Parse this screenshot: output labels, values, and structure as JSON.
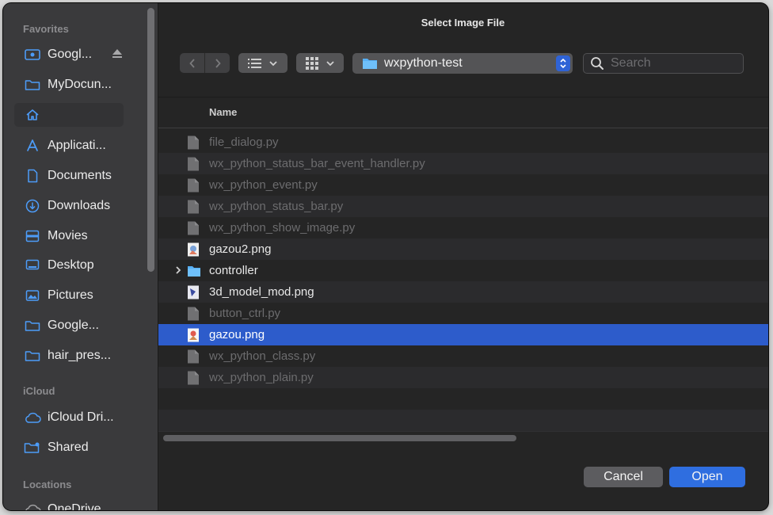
{
  "window": {
    "title": "Select Image File"
  },
  "sidebar": {
    "sections": [
      {
        "label": "Favorites",
        "items": [
          {
            "label": "Googl...",
            "icon": "drive-icon",
            "eject": true
          },
          {
            "label": "MyDocun...",
            "icon": "folder-icon"
          },
          {
            "label": "",
            "icon": "home-icon",
            "active": true
          },
          {
            "label": "Applicati...",
            "icon": "applications-icon"
          },
          {
            "label": "Documents",
            "icon": "document-icon"
          },
          {
            "label": "Downloads",
            "icon": "downloads-icon"
          },
          {
            "label": "Movies",
            "icon": "movies-icon"
          },
          {
            "label": "Desktop",
            "icon": "desktop-icon"
          },
          {
            "label": "Pictures",
            "icon": "pictures-icon"
          },
          {
            "label": "Google...",
            "icon": "folder-icon"
          },
          {
            "label": "hair_pres...",
            "icon": "folder-icon"
          }
        ]
      },
      {
        "label": "iCloud",
        "items": [
          {
            "label": "iCloud Dri...",
            "icon": "cloud-icon"
          },
          {
            "label": "Shared",
            "icon": "shared-folder-icon"
          }
        ]
      },
      {
        "label": "Locations",
        "items": [
          {
            "label": "OneDrive",
            "icon": "cloud-icon"
          }
        ]
      }
    ]
  },
  "toolbar": {
    "path": "wxpython-test",
    "search_placeholder": "Search"
  },
  "list": {
    "column_name": "Name",
    "files": [
      {
        "name": "file_dialog.py",
        "kind": "py",
        "enabled": false
      },
      {
        "name": "wx_python_status_bar_event_handler.py",
        "kind": "py",
        "enabled": false
      },
      {
        "name": "wx_python_event.py",
        "kind": "py",
        "enabled": false
      },
      {
        "name": "wx_python_status_bar.py",
        "kind": "py",
        "enabled": false
      },
      {
        "name": "wx_python_show_image.py",
        "kind": "py",
        "enabled": false
      },
      {
        "name": "gazou2.png",
        "kind": "png",
        "enabled": true
      },
      {
        "name": "controller",
        "kind": "folder",
        "enabled": true
      },
      {
        "name": "3d_model_mod.png",
        "kind": "png",
        "enabled": true
      },
      {
        "name": "button_ctrl.py",
        "kind": "py",
        "enabled": false
      },
      {
        "name": "gazou.png",
        "kind": "png",
        "enabled": true,
        "selected": true
      },
      {
        "name": "wx_python_class.py",
        "kind": "py",
        "enabled": false
      },
      {
        "name": "wx_python_plain.py",
        "kind": "py",
        "enabled": false
      }
    ]
  },
  "buttons": {
    "cancel": "Cancel",
    "open": "Open"
  },
  "colors": {
    "accent": "#2f6ee0",
    "selection": "#2d5ccb"
  }
}
